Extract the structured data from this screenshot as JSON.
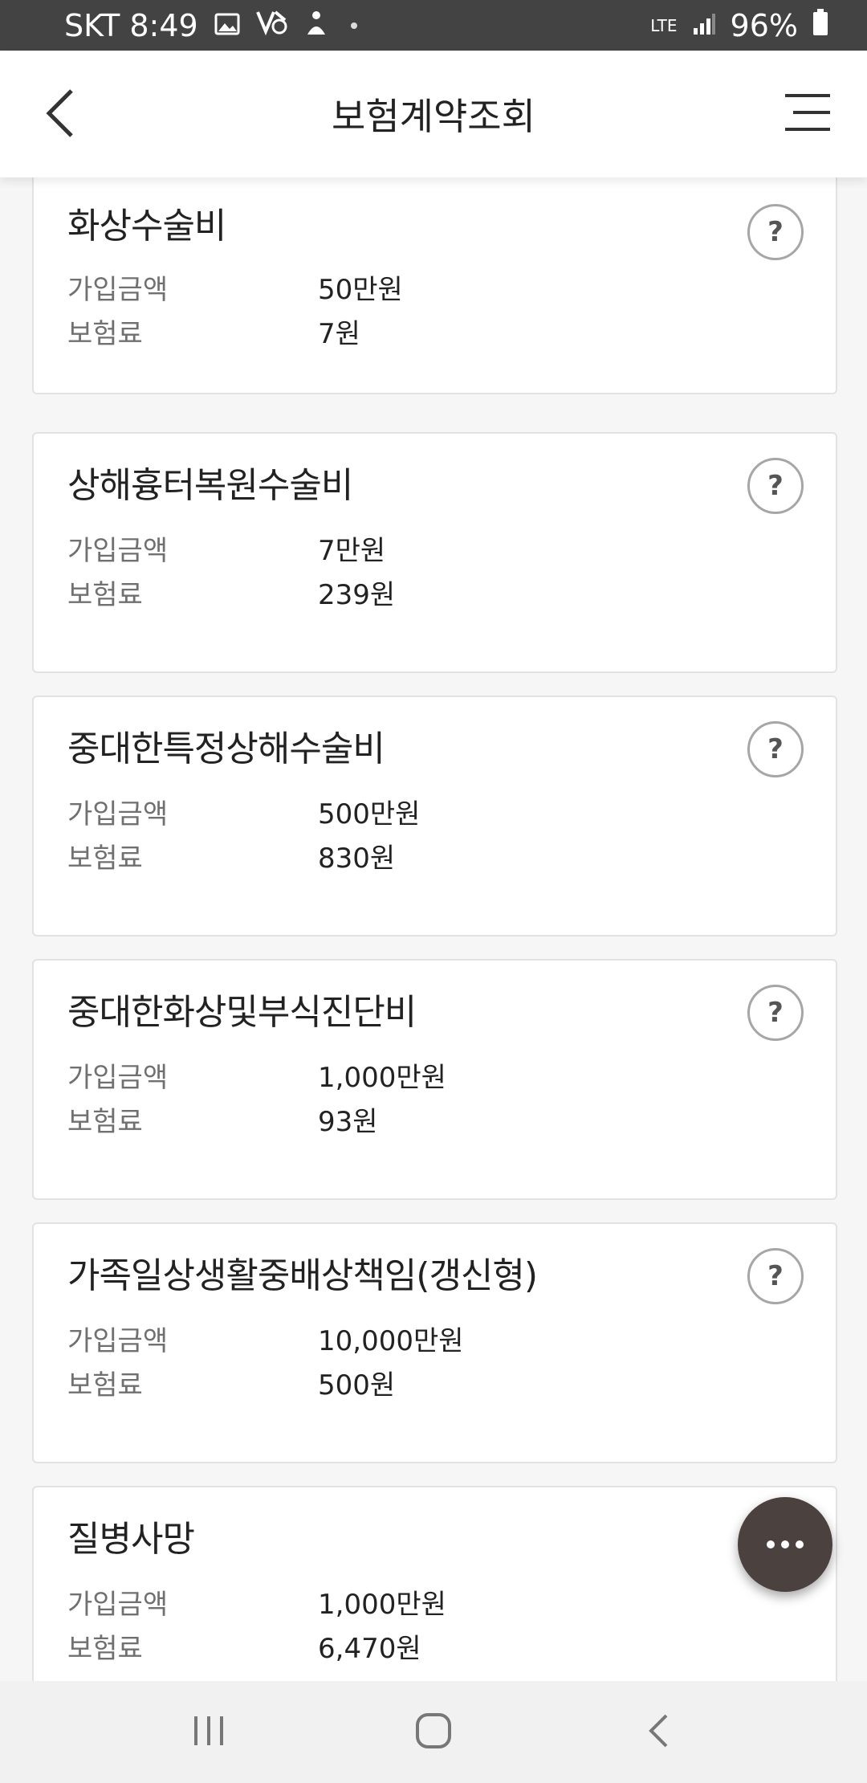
{
  "status_bar": {
    "carrier_time": "SKT 8:49",
    "network": "LTE",
    "battery": "96%"
  },
  "header": {
    "title": "보험계약조회",
    "back_icon": "back-arrow-icon",
    "menu_icon": "hamburger-menu-icon"
  },
  "labels": {
    "amount": "가입금액",
    "premium": "보험료"
  },
  "coverages": [
    {
      "name": "화상수술비",
      "amount": "50만원",
      "premium": "7원"
    },
    {
      "name": "상해흉터복원수술비",
      "amount": "7만원",
      "premium": "239원"
    },
    {
      "name": "중대한특정상해수술비",
      "amount": "500만원",
      "premium": "830원"
    },
    {
      "name": "중대한화상및부식진단비",
      "amount": "1,000만원",
      "premium": "93원"
    },
    {
      "name": "가족일상생활중배상책임(갱신형)",
      "amount": "10,000만원",
      "premium": "500원"
    },
    {
      "name": "질병사망",
      "amount": "1,000만원",
      "premium": "6,470원"
    }
  ],
  "help_symbol": "?",
  "fab_icon": "more-dots-icon",
  "navbar": {
    "recents_icon": "recents-icon",
    "home_icon": "home-icon",
    "back_icon": "nav-back-icon"
  },
  "colors": {
    "status_bar": "#434343",
    "fab": "#4b4240",
    "card_border": "#e2e2e2"
  }
}
